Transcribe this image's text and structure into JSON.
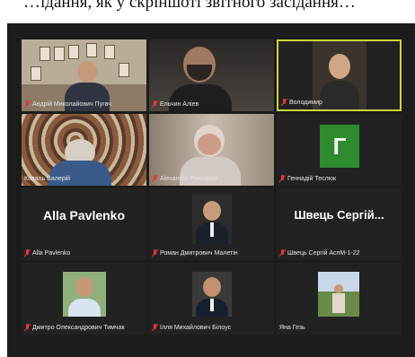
{
  "caption": "…ідання, як у скріншоті звітного засідання…",
  "participants": [
    {
      "name": "Андрій Миколайович Пугач",
      "muted": true
    },
    {
      "name": "Ельчин Аліев",
      "muted": true
    },
    {
      "name": "Володимир",
      "muted": true,
      "active_speaker": true
    },
    {
      "name": "Коваль Валерій",
      "muted": false
    },
    {
      "name": "Alexander Pivovarov",
      "muted": true
    },
    {
      "name": "Геннадій Теслюк",
      "muted": true,
      "avatar_letter": "Г"
    },
    {
      "name": "Alla Pavlenko",
      "muted": true,
      "display_name": "Alla Pavlenko"
    },
    {
      "name": "Роман Дмитрович Малетін",
      "muted": true
    },
    {
      "name": "Швець Сергій АспМ-1-22",
      "muted": true,
      "display_name": "Швець Сергій..."
    },
    {
      "name": "Дмитро Олександрович Тимчак",
      "muted": true
    },
    {
      "name": "Ілля Михайлович Білоус",
      "muted": true
    },
    {
      "name": "Яна Гезь",
      "muted": false
    }
  ],
  "colors": {
    "active_border": "#c9d63a",
    "mic_muted": "#e53935",
    "avatar_bg": "#2e8b2e"
  }
}
